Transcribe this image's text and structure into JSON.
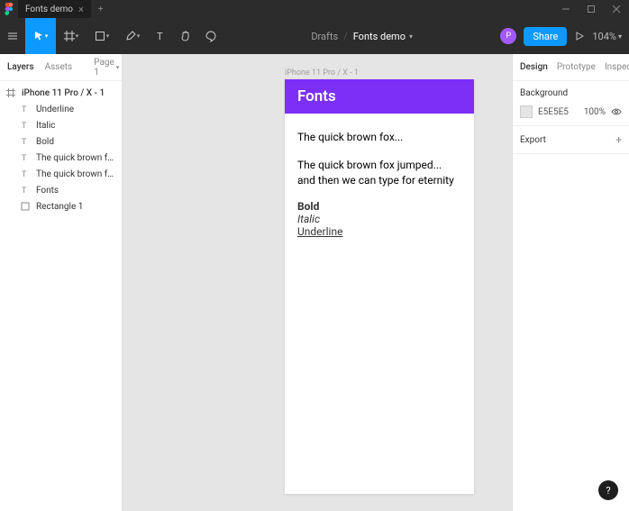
{
  "titlebar": {
    "tab_name": "Fonts demo"
  },
  "toolbar": {
    "breadcrumb_root": "Drafts",
    "file_name": "Fonts demo",
    "share_label": "Share",
    "zoom_level": "104%"
  },
  "left_panel": {
    "tab_layers": "Layers",
    "tab_assets": "Assets",
    "page_label": "Page 1",
    "layers": [
      {
        "type": "frame",
        "name": "iPhone 11 Pro / X - 1"
      },
      {
        "type": "text",
        "name": "Underline"
      },
      {
        "type": "text",
        "name": "Italic"
      },
      {
        "type": "text",
        "name": "Bold"
      },
      {
        "type": "text",
        "name": "The quick brown fox jumped......"
      },
      {
        "type": "text",
        "name": "The quick brown fox..."
      },
      {
        "type": "text",
        "name": "Fonts"
      },
      {
        "type": "rect",
        "name": "Rectangle 1"
      }
    ]
  },
  "canvas": {
    "frame_label": "iPhone 11 Pro / X - 1",
    "header_text": "Fonts",
    "text1": "The quick brown fox...",
    "text2": "The quick brown fox jumped... and then we can type for eternity",
    "bold": "Bold",
    "italic": "Italic",
    "underline": "Underline"
  },
  "right_panel": {
    "tab_design": "Design",
    "tab_prototype": "Prototype",
    "tab_inspect": "Inspect",
    "bg_label": "Background",
    "bg_hex": "E5E5E5",
    "bg_opacity": "100%",
    "export_label": "Export"
  }
}
